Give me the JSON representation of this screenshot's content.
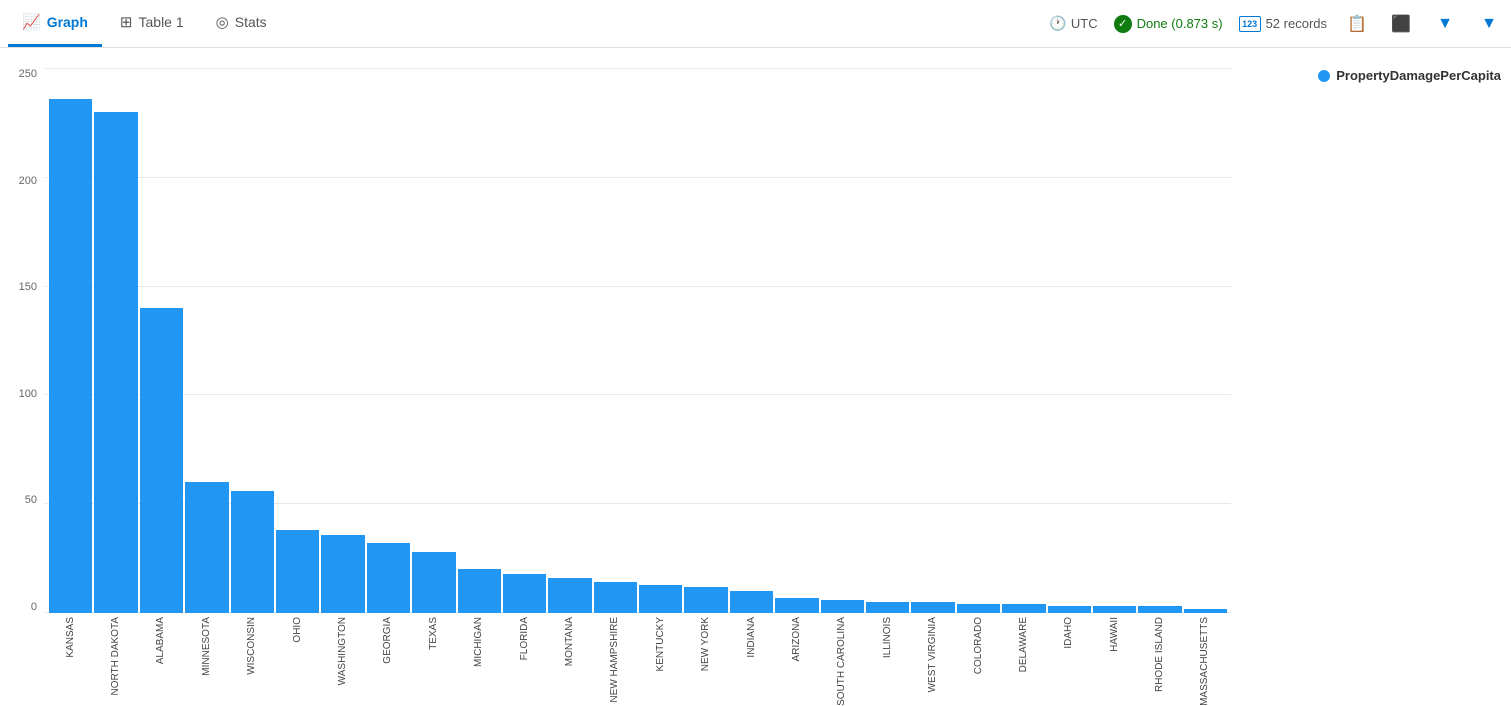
{
  "toolbar": {
    "tab_graph": "Graph",
    "tab_table": "Table 1",
    "tab_stats": "Stats",
    "utc_label": "UTC",
    "done_label": "Done (0.873 s)",
    "records_label": "52 records"
  },
  "chart": {
    "legend_label": "PropertyDamagePerCapita",
    "y_axis_labels": [
      "250",
      "200",
      "150",
      "100",
      "50",
      "0"
    ],
    "max_value": 250,
    "bars": [
      {
        "state": "KANSAS",
        "value": 236
      },
      {
        "state": "NORTH DAKOTA",
        "value": 230
      },
      {
        "state": "ALABAMA",
        "value": 140
      },
      {
        "state": "MINNESOTA",
        "value": 60
      },
      {
        "state": "WISCONSIN",
        "value": 56
      },
      {
        "state": "OHIO",
        "value": 38
      },
      {
        "state": "WASHINGTON",
        "value": 36
      },
      {
        "state": "GEORGIA",
        "value": 32
      },
      {
        "state": "TEXAS",
        "value": 28
      },
      {
        "state": "MICHIGAN",
        "value": 20
      },
      {
        "state": "FLORIDA",
        "value": 18
      },
      {
        "state": "MONTANA",
        "value": 16
      },
      {
        "state": "NEW HAMPSHIRE",
        "value": 14
      },
      {
        "state": "KENTUCKY",
        "value": 13
      },
      {
        "state": "NEW YORK",
        "value": 12
      },
      {
        "state": "INDIANA",
        "value": 10
      },
      {
        "state": "ARIZONA",
        "value": 7
      },
      {
        "state": "SOUTH CAROLINA",
        "value": 6
      },
      {
        "state": "ILLINOIS",
        "value": 5
      },
      {
        "state": "WEST VIRGINIA",
        "value": 5
      },
      {
        "state": "COLORADO",
        "value": 4
      },
      {
        "state": "DELAWARE",
        "value": 4
      },
      {
        "state": "IDAHO",
        "value": 3
      },
      {
        "state": "HAWAII",
        "value": 3
      },
      {
        "state": "RHODE ISLAND",
        "value": 3
      },
      {
        "state": "MASSACHUSETTS",
        "value": 2
      }
    ]
  }
}
